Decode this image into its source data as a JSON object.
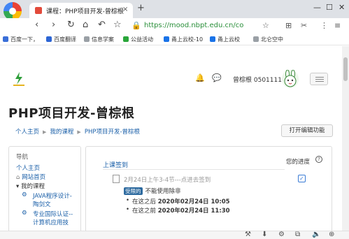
{
  "browser": {
    "tab_title": "课程：PHP项目开发-曾棕根",
    "tab_close": "×",
    "new_tab": "+",
    "address": "https://mood.nbpt.edu.cn/co",
    "bookmarks": [
      {
        "label": "百度一下，",
        "color": "#3a6fd8"
      },
      {
        "label": "百度翻译",
        "color": "#2c65d4"
      },
      {
        "label": "信息学案",
        "color": "#9aa0a6"
      },
      {
        "label": "公益活动",
        "color": "#2aa63a"
      },
      {
        "label": "甬上云校-10",
        "color": "#1a73e8"
      },
      {
        "label": "甬上云校",
        "color": "#1a73e8"
      },
      {
        "label": "北仑空中",
        "color": "#9aa0a6"
      }
    ]
  },
  "header": {
    "username": "曾棕根 0501111"
  },
  "course": {
    "title": "PHP项目开发-曾棕根",
    "breadcrumbs": [
      "个人主页",
      "我的课程",
      "PHP项目开发-曾棕根"
    ],
    "edit_button": "打开编辑功能"
  },
  "nav": {
    "heading": "导航",
    "items": [
      "个人主页",
      "网站首页",
      "我的课程",
      "JAVA程序设计-",
      "陶剑文",
      "专业国际认证--",
      "计算机应用技"
    ]
  },
  "main": {
    "section_title": "上课签到",
    "progress_label": "您的进度",
    "activity": "2月24日上午3-4节---点进去签到",
    "restricted_badge": "受限的",
    "restricted_text": "不能使用除非",
    "conditions": [
      {
        "prefix": "在这之后",
        "date": "2020年02月24日 10:05"
      },
      {
        "prefix": "在这之前",
        "date": "2020年02月24日 11:30"
      }
    ]
  }
}
